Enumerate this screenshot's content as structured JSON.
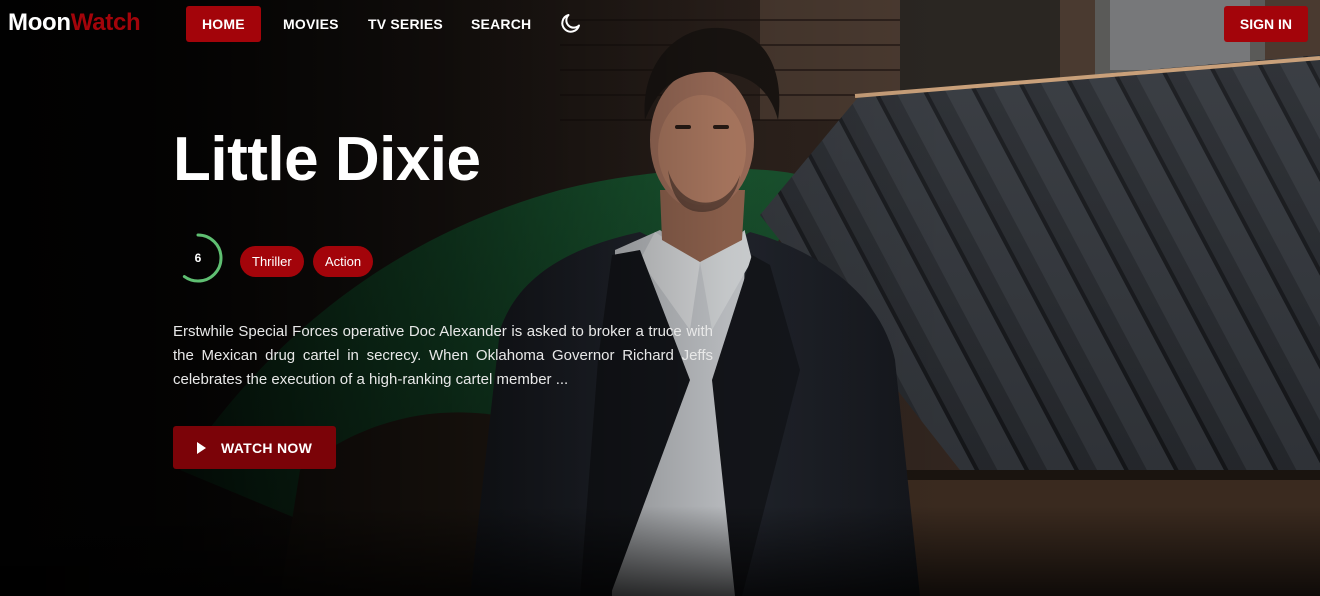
{
  "logo": {
    "part1": "Moon",
    "part2": "Watch"
  },
  "nav": {
    "home": "HOME",
    "movies": "MOVIES",
    "tv_series": "TV SERIES",
    "search": "SEARCH",
    "theme_icon": "moon-icon",
    "sign_in": "SIGN IN"
  },
  "movie": {
    "title": "Little Dixie",
    "rating": "6",
    "rating_fraction": 0.6,
    "genres": [
      "Thriller",
      "Action"
    ],
    "overview": "Erstwhile Special Forces operative Doc Alexander is asked to broker a truce with the Mexican drug cartel in secrecy. When Oklahoma Governor Richard Jeffs celebrates the execution of a high-ranking cartel member ...",
    "watch_label": "WATCH NOW",
    "play_icon": "play-icon"
  },
  "colors": {
    "brand_red": "#a3040a",
    "button_red": "#7b0308",
    "rating_ring": "#5fbf72"
  }
}
